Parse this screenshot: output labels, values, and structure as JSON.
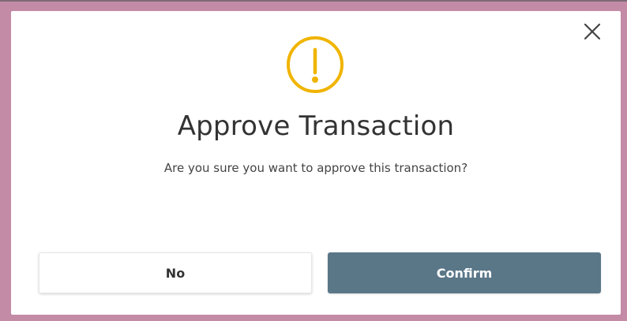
{
  "dialog": {
    "title": "Approve Transaction",
    "message": "Are you sure you want to approve this transaction?",
    "icon": "warning-icon",
    "close_icon": "close-icon",
    "buttons": {
      "no_label": "No",
      "confirm_label": "Confirm"
    }
  },
  "colors": {
    "backdrop": "#c38ba6",
    "warning": "#f0b400",
    "confirm_button": "#5a7788",
    "title_text": "#333333"
  }
}
